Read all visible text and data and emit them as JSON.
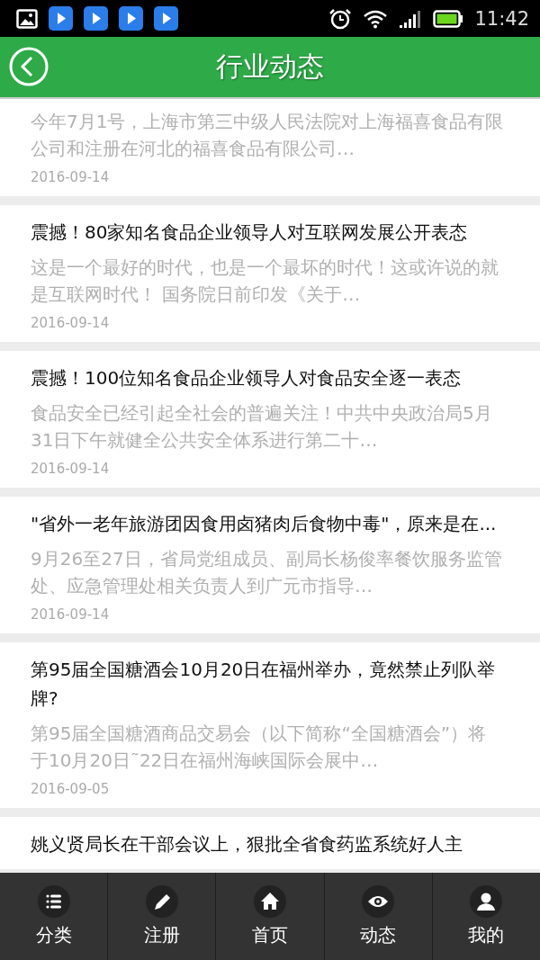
{
  "status_bar": {
    "time": "11:42"
  },
  "header": {
    "title": "行业动态"
  },
  "articles": [
    {
      "summary": "今年7月1号，上海市第三中级人民法院对上海福喜食品有限公司和注册在河北的福喜食品有限公司…",
      "date": "2016-09-14"
    },
    {
      "title": "震撼！80家知名食品企业领导人对互联网发展公开表态",
      "summary": "这是一个最好的时代，也是一个最坏的时代！这或许说的就是互联网时代！ 国务院日前印发《关于…",
      "date": "2016-09-14"
    },
    {
      "title": "震撼！100位知名食品企业领导人对食品安全逐一表态",
      "summary": "食品安全已经引起全社会的普遍关注！中共中央政治局5月31日下午就健全公共安全体系进行第二十…",
      "date": "2016-09-14"
    },
    {
      "title": "\"省外一老年旅游团因食用卤猪肉后食物中毒\"，原来是在...",
      "summary": "9月26至27日，省局党组成员、副局长杨俊率餐饮服务监管处、应急管理处相关负责人到广元市指导…",
      "date": "2016-09-14"
    },
    {
      "title": "第95届全国糖酒会10月20日在福州举办，竟然禁止列队举牌?",
      "summary": "第95届全国糖酒商品交易会（以下简称“全国糖酒会”）将于10月20日˜22日在福州海峡国际会展中…",
      "date": "2016-09-05"
    },
    {
      "title": "姚义贤局长在干部会议上，狠批全省食药监系统好人主"
    }
  ],
  "nav": [
    {
      "label": "分类",
      "kind": "list"
    },
    {
      "label": "注册",
      "kind": "pencil"
    },
    {
      "label": "首页",
      "kind": "home"
    },
    {
      "label": "动态",
      "kind": "eye"
    },
    {
      "label": "我的",
      "kind": "user"
    }
  ]
}
